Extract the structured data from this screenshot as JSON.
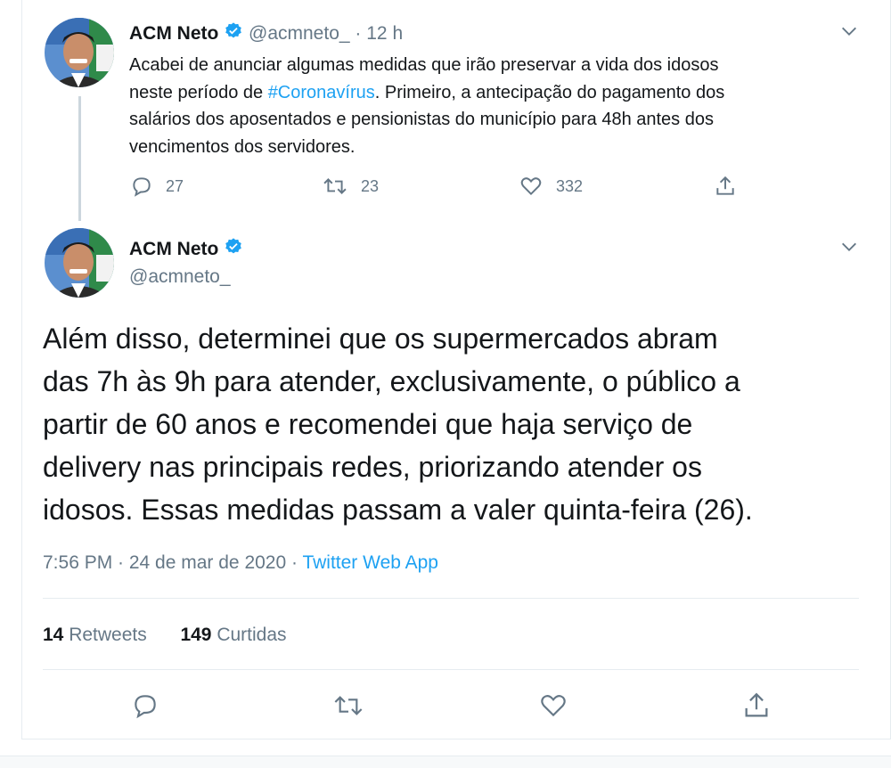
{
  "reply_tweet": {
    "display_name": "ACM Neto",
    "handle": "@acmneto_",
    "separator": "·",
    "time": "12 h",
    "text_1": "Acabei de anunciar algumas medidas que irão preservar a vida dos idosos",
    "text_2a": "neste período de ",
    "hashtag": "#Coronavírus",
    "text_2b": ". Primeiro, a antecipação do pagamento dos",
    "text_3": "salários dos aposentados e pensionistas do município para 48h antes dos",
    "text_4": "vencimentos dos servidores.",
    "reply_count": "27",
    "retweet_count": "23",
    "like_count": "332"
  },
  "main_tweet": {
    "display_name": "ACM Neto",
    "handle": "@acmneto_",
    "lines": [
      "Além disso, determinei que os supermercados abram",
      "das 7h às 9h para atender, exclusivamente, o público a",
      "partir de 60 anos e recomendei que haja serviço de",
      "delivery nas principais redes, priorizando atender os",
      "idosos. Essas medidas passam a valer quinta-feira (26)."
    ],
    "timestamp": "7:56 PM · 24 de mar de 2020 · ",
    "source": "Twitter Web App",
    "retweets_num": "14",
    "retweets_label": "Retweets",
    "likes_num": "149",
    "likes_label": "Curtidas"
  },
  "icons": {
    "verified": "verified-badge-icon",
    "reply": "reply-icon",
    "retweet": "retweet-icon",
    "like": "heart-icon",
    "share": "share-icon",
    "more": "chevron-down-icon"
  },
  "colors": {
    "accent": "#1da1f2",
    "muted": "#657786",
    "text": "#14171a"
  }
}
